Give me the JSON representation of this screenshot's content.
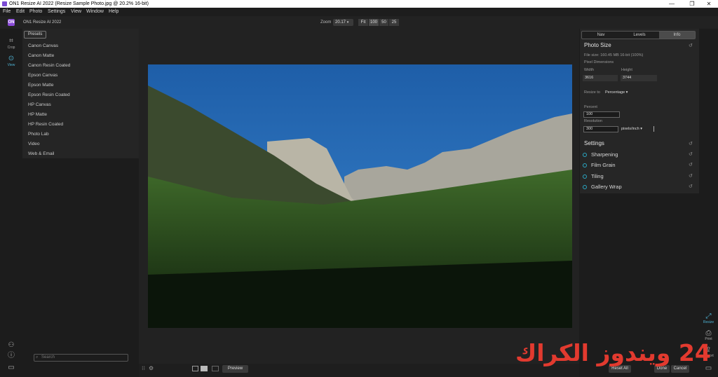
{
  "window": {
    "title": "ON1 Resize AI 2022 (Resize Sample Photo.jpg @ 20.2% 16-bit)",
    "minimize": "—",
    "maximize": "❐",
    "close": "✕"
  },
  "menu": [
    "File",
    "Edit",
    "Photo",
    "Settings",
    "View",
    "Window",
    "Help"
  ],
  "toolbar": {
    "app_name": "ON1 Resize AI 2022",
    "logo": "ON",
    "zoom_label": "Zoom",
    "zoom_value": "20.17",
    "zoom_presets": [
      "Fit",
      "100",
      "50",
      "25"
    ]
  },
  "left_tools": [
    {
      "label": "Crop",
      "icon": "crop-icon"
    },
    {
      "label": "View",
      "icon": "view-icon"
    }
  ],
  "presets": {
    "tab": "Presets",
    "items": [
      "Canon Canvas",
      "Canon Matte",
      "Canon Resin Coated",
      "Epson Canvas",
      "Epson Matte",
      "Epson Resin Coated",
      "HP Canvas",
      "HP Matte",
      "HP Resin Coated",
      "Photo Lab",
      "Video",
      "Web & Email"
    ]
  },
  "search": {
    "placeholder": "Search"
  },
  "right_panel": {
    "tabs": [
      "Nav",
      "Levels",
      "Info"
    ],
    "active_tab": "Info",
    "photo_size": {
      "title": "Photo Size",
      "file_size": "File size: 160.45 MB 16-bit (100%)",
      "pixel_dims": "Pixel Dimensions",
      "width_label": "Width",
      "height_label": "Height",
      "width": "3616",
      "height": "3744",
      "resize_to_label": "Resize to",
      "resize_to_value": "Percentage",
      "percent_label": "Percent",
      "percent_value": "100",
      "resolution_label": "Resolution",
      "resolution_value": "300",
      "resolution_unit": "pixels/inch"
    },
    "settings": {
      "title": "Settings",
      "items": [
        "Sharpening",
        "Film Grain",
        "Tiling",
        "Gallery Wrap"
      ]
    }
  },
  "right_tools": [
    {
      "label": "Resize",
      "icon": "resize-icon"
    },
    {
      "label": "Print",
      "icon": "print-icon"
    },
    {
      "label": "Export",
      "icon": "export-icon"
    }
  ],
  "bottom": {
    "preview": "Preview",
    "reset_all": "Reset All",
    "done": "Done",
    "cancel": "Cancel"
  },
  "watermark": "24 ويندوز الكراك",
  "colors": {
    "accent": "#2aa8c4",
    "brand": "#8b4bd9",
    "watermark": "#e23a2f"
  }
}
